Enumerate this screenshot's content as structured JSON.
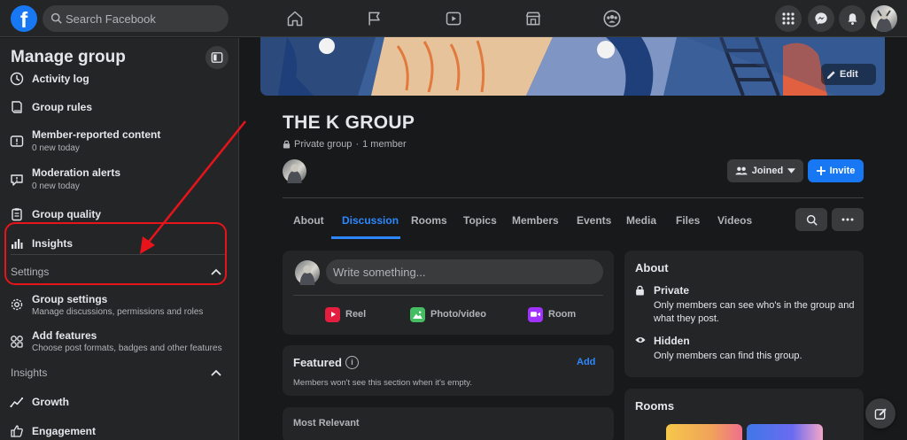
{
  "topbar": {
    "logo": "f",
    "search_placeholder": "Search Facebook",
    "nav_icons": [
      "home-icon",
      "pages-flag-icon",
      "watch-video-icon",
      "marketplace-icon",
      "groups-icon"
    ],
    "right_icons": [
      "menu-grid-icon",
      "messenger-icon",
      "notifications-bell-icon",
      "account-avatar"
    ]
  },
  "sidebar": {
    "title": "Manage group",
    "items_top": [
      {
        "label": "Activity log",
        "sub": "",
        "icon": "clock-icon"
      },
      {
        "label": "Group rules",
        "sub": "",
        "icon": "rules-book-icon"
      },
      {
        "label": "Member-reported content",
        "sub": "0 new today",
        "icon": "report-icon"
      },
      {
        "label": "Moderation alerts",
        "sub": "0 new today",
        "icon": "alert-icon"
      },
      {
        "label": "Group quality",
        "sub": "",
        "icon": "clipboard-icon"
      },
      {
        "label": "Insights",
        "sub": "",
        "icon": "bar-chart-icon"
      }
    ],
    "settings_section": {
      "label": "Settings",
      "items": [
        {
          "label": "Group settings",
          "sub": "Manage discussions, permissions and roles",
          "icon": "gear-icon"
        },
        {
          "label": "Add features",
          "sub": "Choose post formats, badges and other features",
          "icon": "features-icon"
        }
      ]
    },
    "insights_section": {
      "label": "Insights",
      "items": [
        {
          "label": "Growth",
          "icon": "growth-icon"
        },
        {
          "label": "Engagement",
          "icon": "engagement-icon"
        }
      ]
    }
  },
  "cover": {
    "edit_label": "Edit"
  },
  "group": {
    "name": "THE K GROUP",
    "privacy": "Private group",
    "separator": "·",
    "members": "1 member",
    "joined_label": "Joined",
    "invite_label": "Invite"
  },
  "tabs": [
    "About",
    "Discussion",
    "Rooms",
    "Topics",
    "Members",
    "Events",
    "Media",
    "Files",
    "Videos"
  ],
  "active_tab": "Discussion",
  "composer": {
    "placeholder": "Write something...",
    "actions": [
      {
        "label": "Reel",
        "color": "#e41e3f"
      },
      {
        "label": "Photo/video",
        "color": "#45bd62"
      },
      {
        "label": "Room",
        "color": "#a033ff"
      }
    ]
  },
  "featured": {
    "title": "Featured",
    "info_icon": "i",
    "add_label": "Add",
    "note": "Members won't see this section when it's empty."
  },
  "feed": {
    "sort_label": "Most Relevant"
  },
  "about": {
    "title": "About",
    "private_title": "Private",
    "private_desc": "Only members can see who's in the group and what they post.",
    "hidden_title": "Hidden",
    "hidden_desc": "Only members can find this group."
  },
  "rooms": {
    "title": "Rooms"
  },
  "colors": {
    "accent": "#2d88ff",
    "brand": "#1877f2",
    "highlight": "#e8141b"
  }
}
